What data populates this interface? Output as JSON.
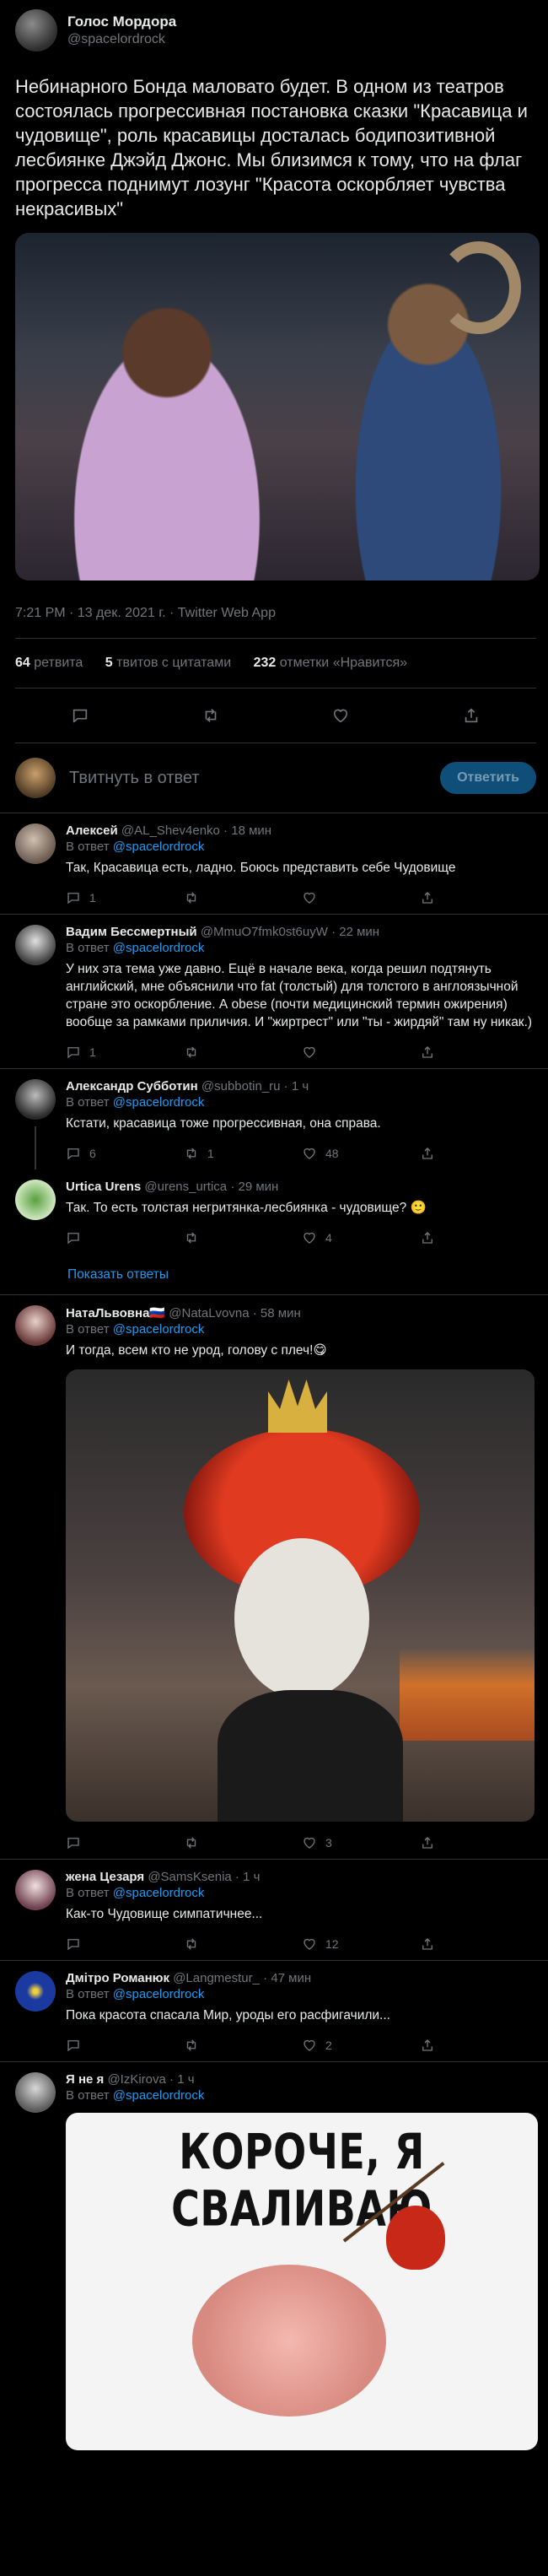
{
  "main": {
    "author_name": "Голос Мордора",
    "author_handle": "@spacelordrock",
    "text": "Небинарного Бонда маловато будет. В одном из театров состоялась прогрессивная постановка сказки \"Красавица и чудовище\", роль красавицы досталась бодипозитивной лесбиянке Джэйд Джонс. Мы близимся к тому, что на флаг прогресса поднимут лозунг \"Красота оскорбляет чувства некрасивых\"",
    "meta": "7:21 PM · 13 дек. 2021 г. · Twitter Web App",
    "retweets_count": "64",
    "retweets_label": "ретвита",
    "quotes_count": "5",
    "quotes_label": "твитов с цитатами",
    "likes_count": "232",
    "likes_label": "отметки «Нравится»"
  },
  "reply_box": {
    "placeholder": "Твитнуть в ответ",
    "button": "Ответить"
  },
  "replies": [
    {
      "name": "Алексей",
      "handle": "@AL_Shev4enko",
      "time": "18 мин",
      "reply_to": "В ответ",
      "reply_to_handle": "@spacelordrock",
      "text": "Так, Красавица есть, ладно. Боюсь представить себе Чудовище",
      "comments": "1",
      "retweets": "",
      "likes": ""
    },
    {
      "name": "Вадим Бессмертный",
      "handle": "@MmuO7fmk0st6uyW",
      "time": "22 мин",
      "reply_to": "В ответ",
      "reply_to_handle": "@spacelordrock",
      "text": "У них эта тема уже давно. Ещё в начале века, когда решил подтянуть английский, мне объяснили что fat (толстый) для толстого в англоязычной стране это оскорбление. А obese (почти медицинский термин ожирения) вообще за рамками приличия. И \"жиртрест\" или \"ты - жирдяй\" там ну никак.)",
      "comments": "1",
      "retweets": "",
      "likes": ""
    },
    {
      "name": "Александр Субботин",
      "handle": "@subbotin_ru",
      "time": "1 ч",
      "reply_to": "В ответ",
      "reply_to_handle": "@spacelordrock",
      "text": "Кстати, красавица тоже прогрессивная, она справа.",
      "comments": "6",
      "retweets": "1",
      "likes": "48"
    },
    {
      "name": "Urtica Urens",
      "handle": "@urens_urtica",
      "time": "29 мин",
      "text": "Так. То есть толстая негритянка-лесбиянка - чудовище? 🙂",
      "comments": "",
      "retweets": "",
      "likes": "4"
    },
    {
      "name": "НатаЛьвовна🇷🇺",
      "handle": "@NataLvovna",
      "time": "58 мин",
      "reply_to": "В ответ",
      "reply_to_handle": "@spacelordrock",
      "text": "И тогда, всем кто не урод, голову с плеч!😋",
      "comments": "",
      "retweets": "",
      "likes": "3"
    },
    {
      "name": "жена Цезаря",
      "handle": "@SamsKsenia",
      "time": "1 ч",
      "reply_to": "В ответ",
      "reply_to_handle": "@spacelordrock",
      "text": "Как-то Чудовище симпатичнее...",
      "comments": "",
      "retweets": "",
      "likes": "12"
    },
    {
      "name": "Дмітро Романюк",
      "handle": "@Langmestur_",
      "time": "47 мин",
      "reply_to": "В ответ",
      "reply_to_handle": "@spacelordrock",
      "text": "Пока красота спасала Мир, уроды его расфигачили...",
      "comments": "",
      "retweets": "",
      "likes": "2"
    },
    {
      "name": "Я не я",
      "handle": "@IzKirova",
      "time": "1 ч",
      "reply_to": "В ответ",
      "reply_to_handle": "@spacelordrock",
      "text": "",
      "image_caption": "КОРОЧЕ, Я СВАЛИВАЮ"
    }
  ],
  "show_replies": "Показать ответы",
  "icons": {
    "reply": "comment-icon",
    "retweet": "retweet-icon",
    "like": "heart-icon",
    "share": "share-icon"
  },
  "colors": {
    "background": "#000000",
    "link": "#1d9bf0",
    "muted": "#71767b",
    "button": "#0f4e78"
  }
}
